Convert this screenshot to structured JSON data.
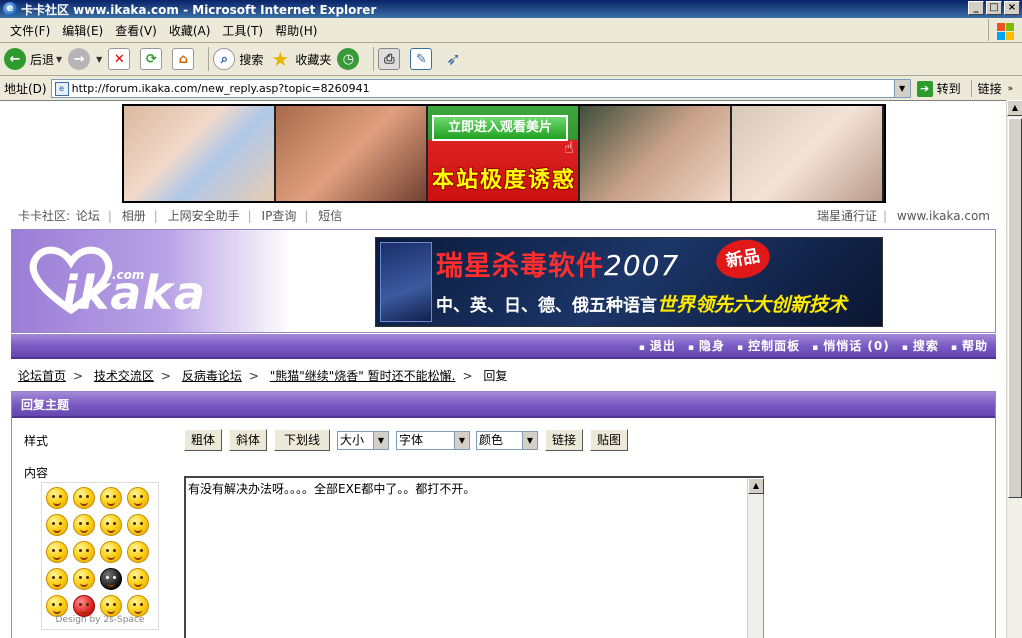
{
  "window": {
    "title": "卡卡社区 www.ikaka.com - Microsoft Internet Explorer",
    "controls": [
      "_",
      "□",
      "×"
    ]
  },
  "menu": [
    "文件(F)",
    "编辑(E)",
    "查看(V)",
    "收藏(A)",
    "工具(T)",
    "帮助(H)"
  ],
  "toolbar": {
    "back": "后退",
    "search": "搜索",
    "favorites": "收藏夹"
  },
  "address": {
    "label": "地址(D)",
    "url": "http://forum.ikaka.com/new_reply.asp?topic=8260941",
    "go": "转到",
    "links": "链接"
  },
  "banner": {
    "cta": "立即进入观看美片",
    "slogan": "本站极度诱惑"
  },
  "topnav": {
    "site": "卡卡社区:",
    "links": [
      "论坛",
      "相册",
      "上网安全助手",
      "IP查询",
      "短信"
    ],
    "right": [
      "瑞星通行证",
      "www.ikaka.com"
    ]
  },
  "header": {
    "logo_text": "ikaka",
    "logo_dotcom": ".com",
    "ad_line1": "瑞星杀毒软件",
    "ad_year": "2007",
    "ad_new": "新品",
    "ad_line2": "中、英、日、德、俄五种语言",
    "ad_line2_highlight": "世界领先六大创新技术"
  },
  "navbar": [
    "退出",
    "隐身",
    "控制面板",
    "悄悄话 (0)",
    "搜索",
    "帮助"
  ],
  "breadcrumb": {
    "items": [
      "论坛首页",
      "技术交流区",
      "反病毒论坛",
      "\"熊猫\"继续\"烧香\" 暂时还不能松懈."
    ],
    "current": "回复"
  },
  "reply": {
    "title": "回复主题",
    "style_label": "样式",
    "content_label": "内容",
    "buttons": {
      "bold": "粗体",
      "italic": "斜体",
      "underline": "下划线",
      "link": "链接",
      "image": "贴图"
    },
    "selects": {
      "size": "大小",
      "font": "字体",
      "color": "颜色"
    },
    "content_text": "有没有解决办法呀。。。。全部EXE都中了。。都打不开。",
    "emoji_credit": "Design by 2s-Space"
  }
}
